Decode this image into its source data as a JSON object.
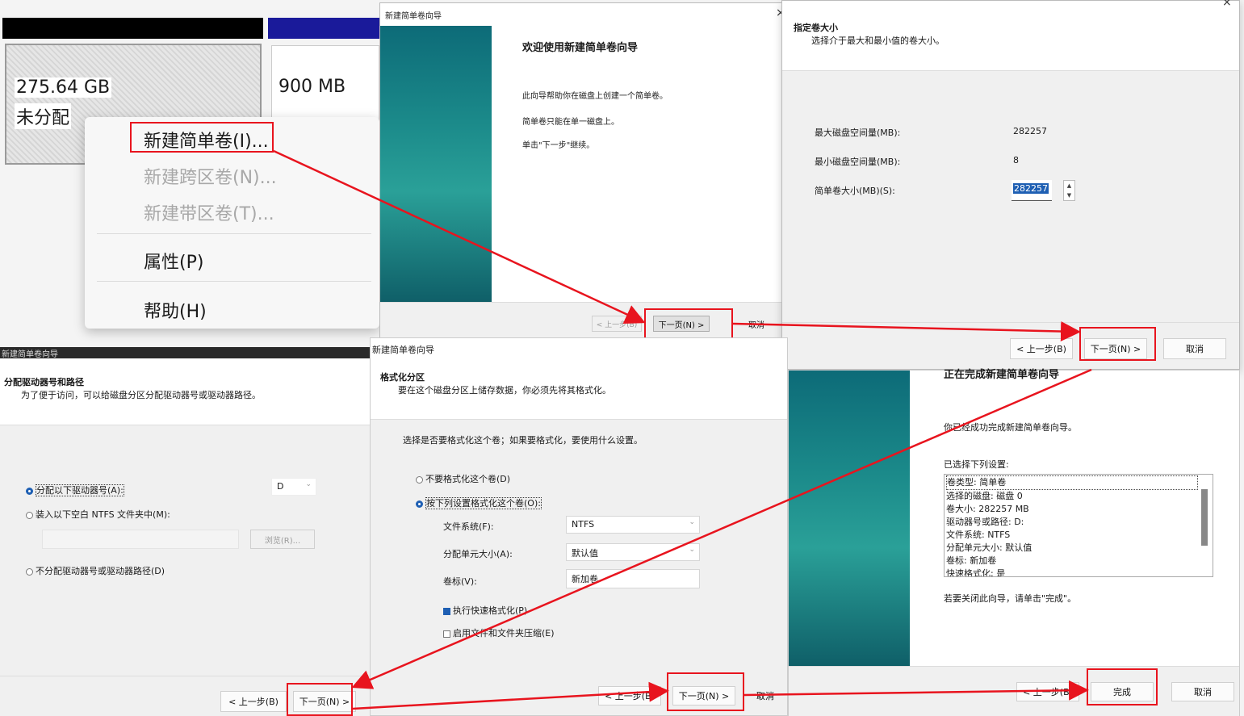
{
  "disk": {
    "unallocated_size": "275.64 GB",
    "unallocated_label": "未分配",
    "partition_size": "900 MB"
  },
  "context_menu": {
    "items": [
      {
        "label": "新建简单卷(I)...",
        "enabled": true
      },
      {
        "label": "新建跨区卷(N)...",
        "enabled": false
      },
      {
        "label": "新建带区卷(T)...",
        "enabled": false
      },
      {
        "label": "属性(P)",
        "enabled": true
      },
      {
        "label": "帮助(H)",
        "enabled": true
      }
    ]
  },
  "welcome": {
    "window_title": "新建简单卷向导",
    "close": "×",
    "heading": "欢迎使用新建简单卷向导",
    "line1": "此向导帮助你在磁盘上创建一个简单卷。",
    "line2": "简单卷只能在单一磁盘上。",
    "line3": "单击\"下一步\"继续。",
    "back": "< 上一步(B)",
    "next": "下一页(N) >",
    "cancel": "取消"
  },
  "size": {
    "window_title": "新建简单卷向导",
    "close": "×",
    "heading": "指定卷大小",
    "subheading": "选择介于最大和最小值的卷大小。",
    "max_label": "最大磁盘空间量(MB):",
    "max_value": "282257",
    "min_label": "最小磁盘空间量(MB):",
    "min_value": "8",
    "size_label": "简单卷大小(MB)(S):",
    "size_value": "282257",
    "back": "< 上一步(B)",
    "next": "下一页(N) >",
    "cancel": "取消"
  },
  "drive": {
    "window_title": "新建简单卷向导",
    "heading": "分配驱动器号和路径",
    "subheading": "为了便于访问，可以给磁盘分区分配驱动器号或驱动器路径。",
    "opt1": "分配以下驱动器号(A):",
    "opt1_value": "D",
    "opt2": "装入以下空白 NTFS 文件夹中(M):",
    "browse": "浏览(R)...",
    "opt3": "不分配驱动器号或驱动器路径(D)",
    "back": "< 上一步(B)",
    "next": "下一页(N) >"
  },
  "format": {
    "window_title": "新建简单卷向导",
    "heading": "格式化分区",
    "subheading": "要在这个磁盘分区上储存数据，你必须先将其格式化。",
    "question": "选择是否要格式化这个卷；如果要格式化，要使用什么设置。",
    "opt_no": "不要格式化这个卷(D)",
    "opt_yes": "按下列设置格式化这个卷(O):",
    "fs_label": "文件系统(F):",
    "fs_value": "NTFS",
    "unit_label": "分配单元大小(A):",
    "unit_value": "默认值",
    "vol_label": "卷标(V):",
    "vol_value": "新加卷",
    "quick": "执行快速格式化(P)",
    "compress": "启用文件和文件夹压缩(E)",
    "back": "< 上一步(B)",
    "next": "下一页(N) >",
    "cancel": "取消"
  },
  "finish": {
    "heading": "正在完成新建简单卷向导",
    "done_text": "你已经成功完成新建简单卷向导。",
    "selected_label": "已选择下列设置:",
    "settings": [
      "卷类型: 简单卷",
      "选择的磁盘: 磁盘 0",
      "卷大小: 282257 MB",
      "驱动器号或路径: D:",
      "文件系统: NTFS",
      "分配单元大小: 默认值",
      "卷标: 新加卷",
      "快速格式化: 是"
    ],
    "close_hint": "若要关闭此向导，请单击\"完成\"。",
    "back": "< 上一步(B)",
    "finish": "完成",
    "cancel": "取消"
  },
  "colors": {
    "accent_red": "#e8141e",
    "selection_blue": "#1e5fb3"
  }
}
